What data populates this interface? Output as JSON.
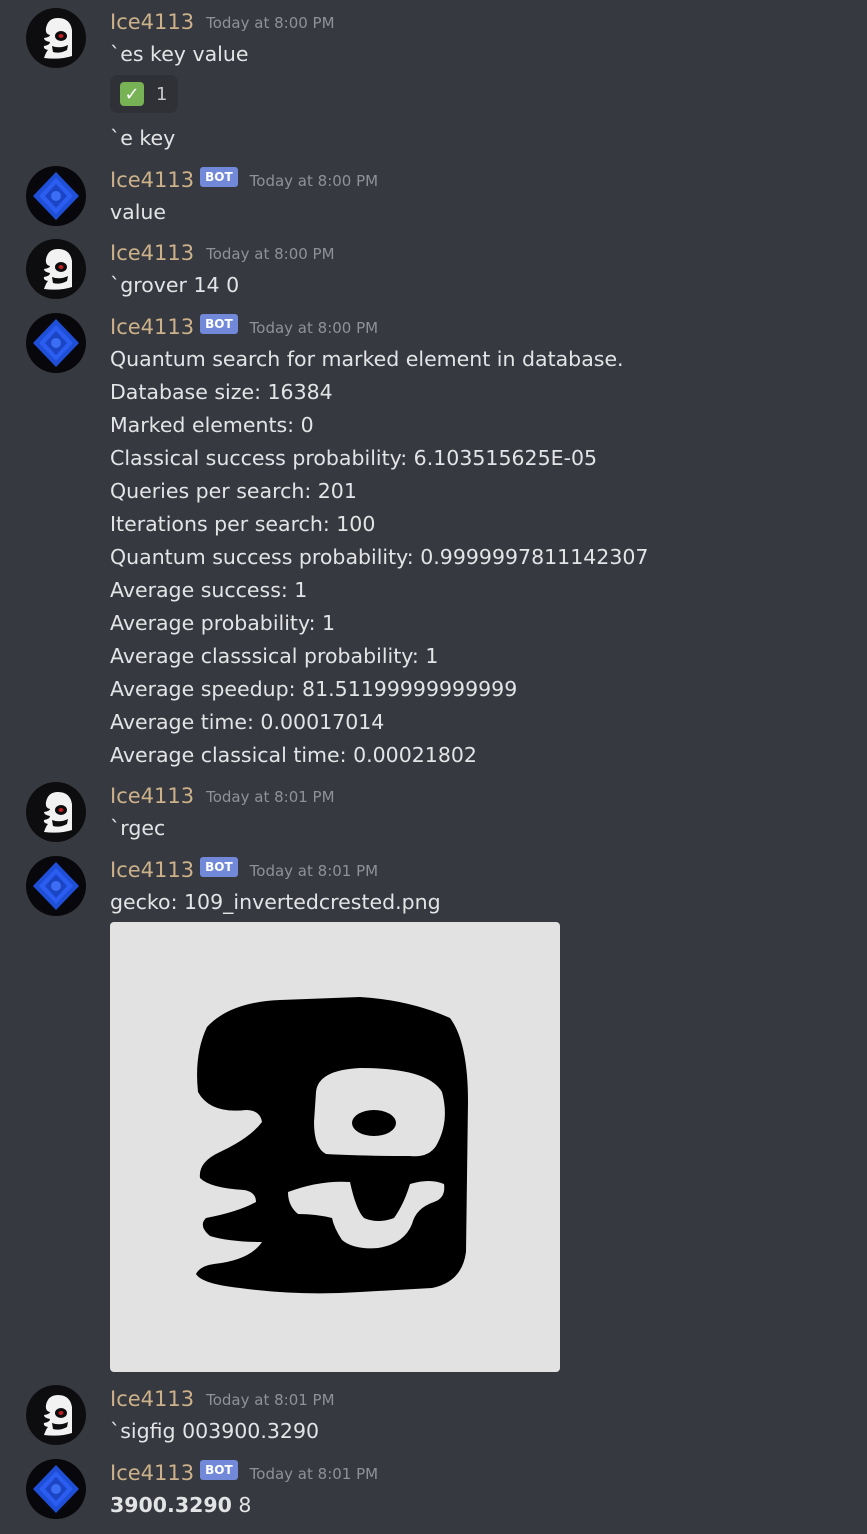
{
  "messages": [
    {
      "user": "Ice4113",
      "time": "Today at 8:00 PM",
      "lines": [
        "`es key value"
      ],
      "reaction": {
        "emoji": "✓",
        "count": "1"
      },
      "extra_line": "`e key"
    },
    {
      "user": "Ice4113",
      "bot_tag": "BOT",
      "time": "Today at 8:00 PM",
      "lines": [
        "value"
      ]
    },
    {
      "user": "Ice4113",
      "time": "Today at 8:00 PM",
      "lines": [
        "`grover 14 0"
      ]
    },
    {
      "user": "Ice4113",
      "bot_tag": "BOT",
      "time": "Today at 8:00 PM",
      "lines": [
        "Quantum search for marked element in database.",
        "Database size: 16384",
        "Marked elements: 0",
        "Classical success probability: 6.103515625E-05",
        "Queries per search: 201",
        "Iterations per search: 100",
        "Quantum success probability: 0.9999997811142307",
        "Average success: 1",
        "Average probability: 1",
        "Average classsical probability: 1",
        "Average speedup: 81.51199999999999",
        "Average time: 0.00017014",
        "Average classical time: 0.00021802"
      ]
    },
    {
      "user": "Ice4113",
      "time": "Today at 8:01 PM",
      "lines": [
        "`rgec"
      ]
    },
    {
      "user": "Ice4113",
      "bot_tag": "BOT",
      "time": "Today at 8:01 PM",
      "lines": [
        "gecko: 109_invertedcrested.png"
      ]
    },
    {
      "user": "Ice4113",
      "time": "Today at 8:01 PM",
      "lines": [
        "`sigfig 003900.3290"
      ]
    },
    {
      "user": "Ice4113",
      "bot_tag": "BOT",
      "time": "Today at 8:01 PM",
      "result_bold": "3900.3290",
      "result_rest": " 8"
    }
  ],
  "colors": {
    "background": "#36393f",
    "username": "#ccb18a",
    "timestamp": "#8e9297",
    "bot_tag": "#7289da"
  }
}
